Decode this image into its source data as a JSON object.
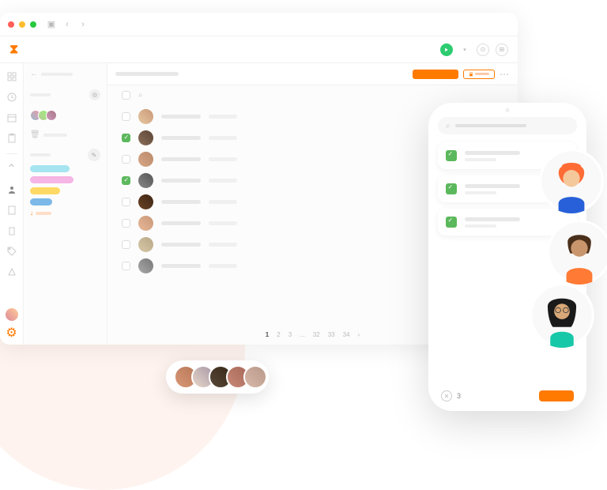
{
  "colors": {
    "accent": "#ff7a00",
    "success": "#5cb85c",
    "play": "#2ecc71"
  },
  "sidebar": {
    "tags": [
      {
        "color": "cyan"
      },
      {
        "color": "pink"
      },
      {
        "color": "yellow"
      },
      {
        "color": "blue"
      }
    ]
  },
  "list": {
    "rows": [
      {
        "checked": false,
        "avatar": "linear-gradient(45deg,#e8c8a0,#c89878)"
      },
      {
        "checked": true,
        "avatar": "linear-gradient(45deg,#8b6f5c,#5c4434)"
      },
      {
        "checked": false,
        "avatar": "linear-gradient(45deg,#d8a888,#b88868)"
      },
      {
        "checked": true,
        "avatar": "linear-gradient(45deg,#888,#555)"
      },
      {
        "checked": false,
        "avatar": "linear-gradient(45deg,#6b4226,#3e2614)"
      },
      {
        "checked": false,
        "avatar": "linear-gradient(45deg,#e8b898,#c89878)"
      },
      {
        "checked": false,
        "avatar": "linear-gradient(45deg,#d8c8a8,#b8a888)"
      },
      {
        "checked": false,
        "avatar": "linear-gradient(45deg,#aaa,#777)"
      }
    ]
  },
  "pager": {
    "pages": [
      "1",
      "2",
      "3",
      "...",
      "32",
      "33",
      "34"
    ],
    "current": "1"
  },
  "pill": {
    "avatars": [
      "linear-gradient(45deg,#d89878,#b87858)",
      "linear-gradient(45deg,#e8d8c8,#a898a8)",
      "linear-gradient(45deg,#584838,#382818)",
      "linear-gradient(45deg,#c88878,#a86858)",
      "linear-gradient(45deg,#d8b8a8,#b89888)"
    ]
  },
  "phone": {
    "items": [
      {
        "checked": true
      },
      {
        "checked": true
      },
      {
        "checked": true
      }
    ],
    "footer_count": "3"
  }
}
